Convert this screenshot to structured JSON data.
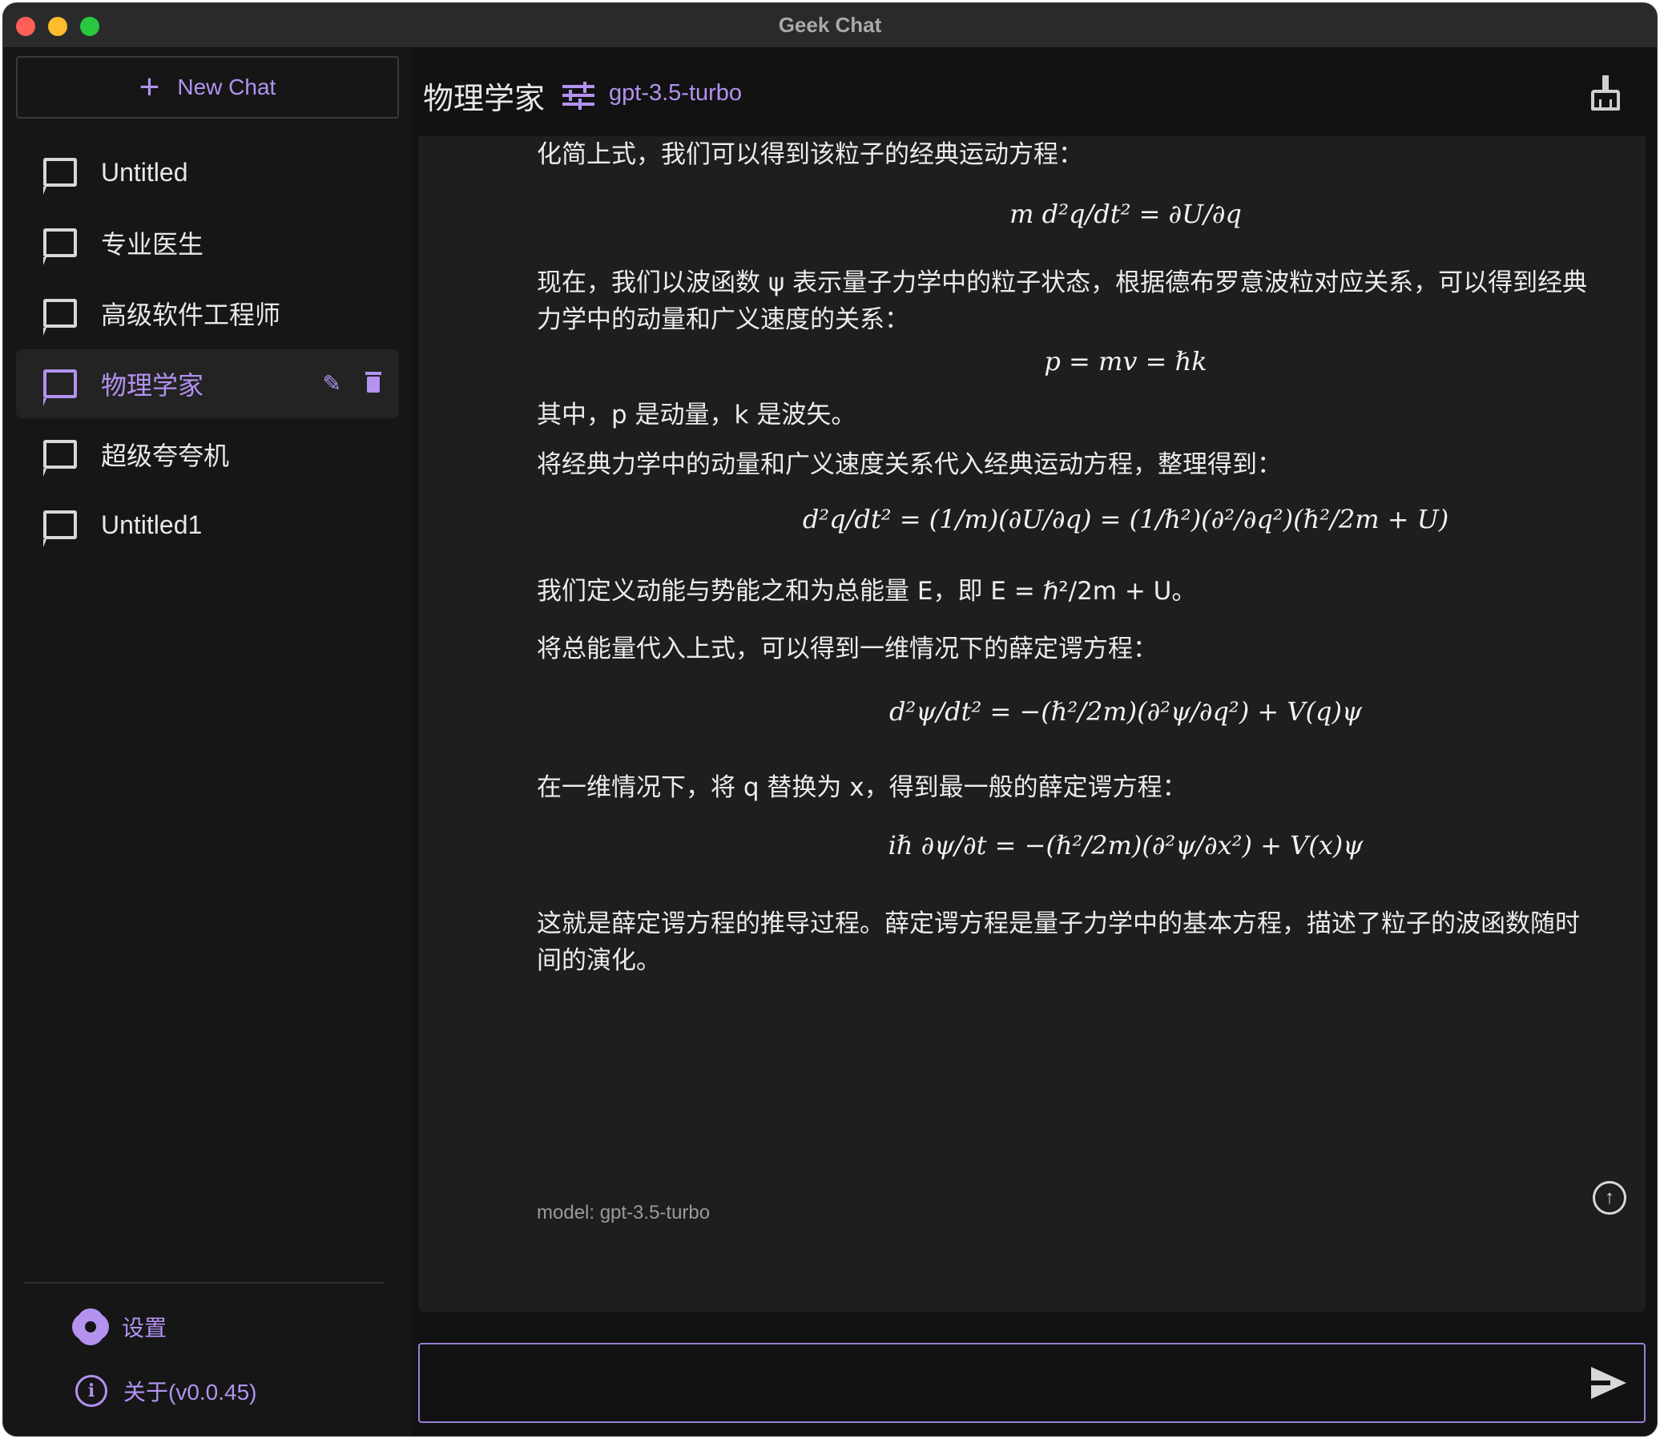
{
  "window": {
    "title": "Geek Chat"
  },
  "sidebar": {
    "new_chat_label": "New Chat",
    "chats": [
      {
        "label": "Untitled"
      },
      {
        "label": "专业医生"
      },
      {
        "label": "高级软件工程师"
      },
      {
        "label": "物理学家",
        "active": true
      },
      {
        "label": "超级夸夸机"
      },
      {
        "label": "Untitled1"
      }
    ],
    "settings_label": "设置",
    "about_label": "关于(v0.0.45)"
  },
  "header": {
    "title": "物理学家",
    "model": "gpt-3.5-turbo"
  },
  "message": {
    "lines": [
      "化简上式，我们可以得到该粒子的经典运动方程：",
      "m d²q/dt² = ∂U/∂q",
      "现在，我们以波函数 ψ 表示量子力学中的粒子状态，根据德布罗意波粒对应关系，可以得到经典力学中的动量和广义速度的关系：",
      "p = mv = ℏk",
      "其中，p 是动量，k 是波矢。",
      "将经典力学中的动量和广义速度关系代入经典运动方程，整理得到：",
      "d²q/dt² = (1/m)(∂U/∂q) = (1/ℏ²)(∂²/∂q²)(ℏ²/2m + U)",
      "我们定义动能与势能之和为总能量 E，即 E = ℏ²/2m + U。",
      "将总能量代入上式，可以得到一维情况下的薛定谔方程：",
      "d²ψ/dt² = −(ℏ²/2m)(∂²ψ/∂q²) + V(q)ψ",
      "在一维情况下，将 q 替换为 x，得到最一般的薛定谔方程：",
      "iℏ ∂ψ/∂t = −(ℏ²/2m)(∂²ψ/∂x²) + V(x)ψ",
      "这就是薛定谔方程的推导过程。薛定谔方程是量子力学中的基本方程，描述了粒子的波函数随时间的演化。"
    ],
    "model_tag": "model: gpt-3.5-turbo"
  },
  "composer": {
    "value": "",
    "placeholder": ""
  },
  "colors": {
    "accent": "#b392f0",
    "background": "#1e1e1e",
    "sidebar": "#161616"
  },
  "icons": [
    "plus-icon",
    "chat-bubble-icon",
    "pencil-icon",
    "trash-icon",
    "gear-icon",
    "info-icon",
    "sliders-icon",
    "broom-icon",
    "arrow-up-circle-icon",
    "send-icon"
  ]
}
